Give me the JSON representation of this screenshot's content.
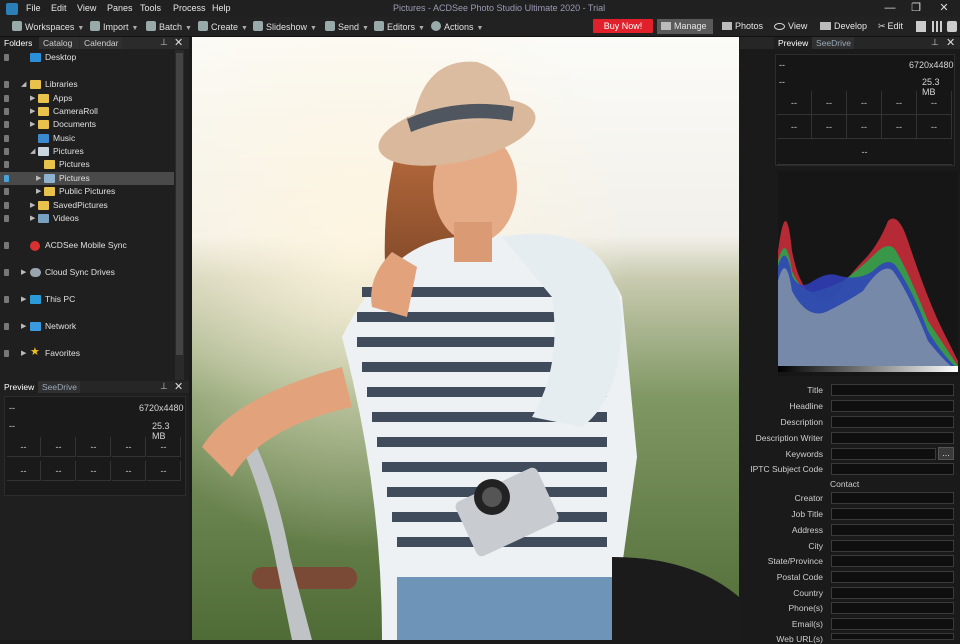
{
  "app": {
    "window_title": "Pictures - ACDSee Photo Studio Ultimate 2020 - Trial",
    "menu": [
      "File",
      "Edit",
      "View",
      "Panes",
      "Tools",
      "Process",
      "Help"
    ],
    "window_controls": [
      "—",
      "❐",
      "✕"
    ]
  },
  "toolbar": {
    "items": [
      "Workspaces",
      "Import",
      "Batch",
      "Create",
      "Slideshow",
      "Send",
      "Editors",
      "Actions"
    ],
    "buy_now": "Buy Now!",
    "modes": [
      "Manage",
      "Photos",
      "View",
      "Develop",
      "Edit"
    ]
  },
  "left_panel": {
    "tabs": [
      "Folders",
      "Catalog",
      "Calendar"
    ],
    "tree": [
      {
        "label": "Desktop",
        "level": 0,
        "icon": "desktop-icon"
      },
      {
        "label": "Libraries",
        "level": 0,
        "icon": "libraries-icon"
      },
      {
        "label": "Apps",
        "level": 1,
        "icon": "folder-icon"
      },
      {
        "label": "CameraRoll",
        "level": 1,
        "icon": "folder-icon"
      },
      {
        "label": "Documents",
        "level": 1,
        "icon": "folder-icon"
      },
      {
        "label": "Music",
        "level": 1,
        "icon": "music-icon"
      },
      {
        "label": "Pictures",
        "level": 1,
        "icon": "folder-icon"
      },
      {
        "label": "Pictures",
        "level": 2,
        "icon": "folder-icon"
      },
      {
        "label": "Pictures",
        "level": 2,
        "icon": "folder-icon",
        "selected": true
      },
      {
        "label": "Public Pictures",
        "level": 2,
        "icon": "folder-icon"
      },
      {
        "label": "SavedPictures",
        "level": 1,
        "icon": "folder-icon"
      },
      {
        "label": "Videos",
        "level": 1,
        "icon": "folder-icon"
      },
      {
        "label": "ACDSee Mobile Sync",
        "level": 0,
        "icon": "mobile-sync-icon"
      },
      {
        "label": "Cloud Sync Drives",
        "level": 0,
        "icon": "cloud-icon"
      },
      {
        "label": "This PC",
        "level": 0,
        "icon": "computer-icon"
      },
      {
        "label": "Network",
        "level": 0,
        "icon": "network-icon"
      },
      {
        "label": "Favorites",
        "level": 0,
        "icon": "star-icon"
      }
    ],
    "preview_tabs": [
      "Preview",
      "SeeDrive"
    ],
    "preview": {
      "dimensions": "6720x4480",
      "size": "25.3 MB",
      "placeholder": "--"
    }
  },
  "right_panel": {
    "tabs": [
      "Preview",
      "SeeDrive"
    ],
    "preview": {
      "dimensions": "6720x4480",
      "size": "25.3 MB",
      "placeholder": "--"
    },
    "metadata": {
      "fields_top": [
        "Title",
        "Headline",
        "Description",
        "Description Writer",
        "Keywords",
        "IPTC Subject Code"
      ],
      "section": "Contact",
      "fields_contact": [
        "Creator",
        "Job Title",
        "Address",
        "City",
        "State/Province",
        "Postal Code",
        "Country",
        "Phone(s)",
        "Email(s)",
        "Web URL(s)"
      ],
      "more_button": "..."
    }
  },
  "colors": {
    "accent_blue": "#2a7fb8",
    "buy_now": "#e0202a",
    "folder": "#e8c24a"
  }
}
